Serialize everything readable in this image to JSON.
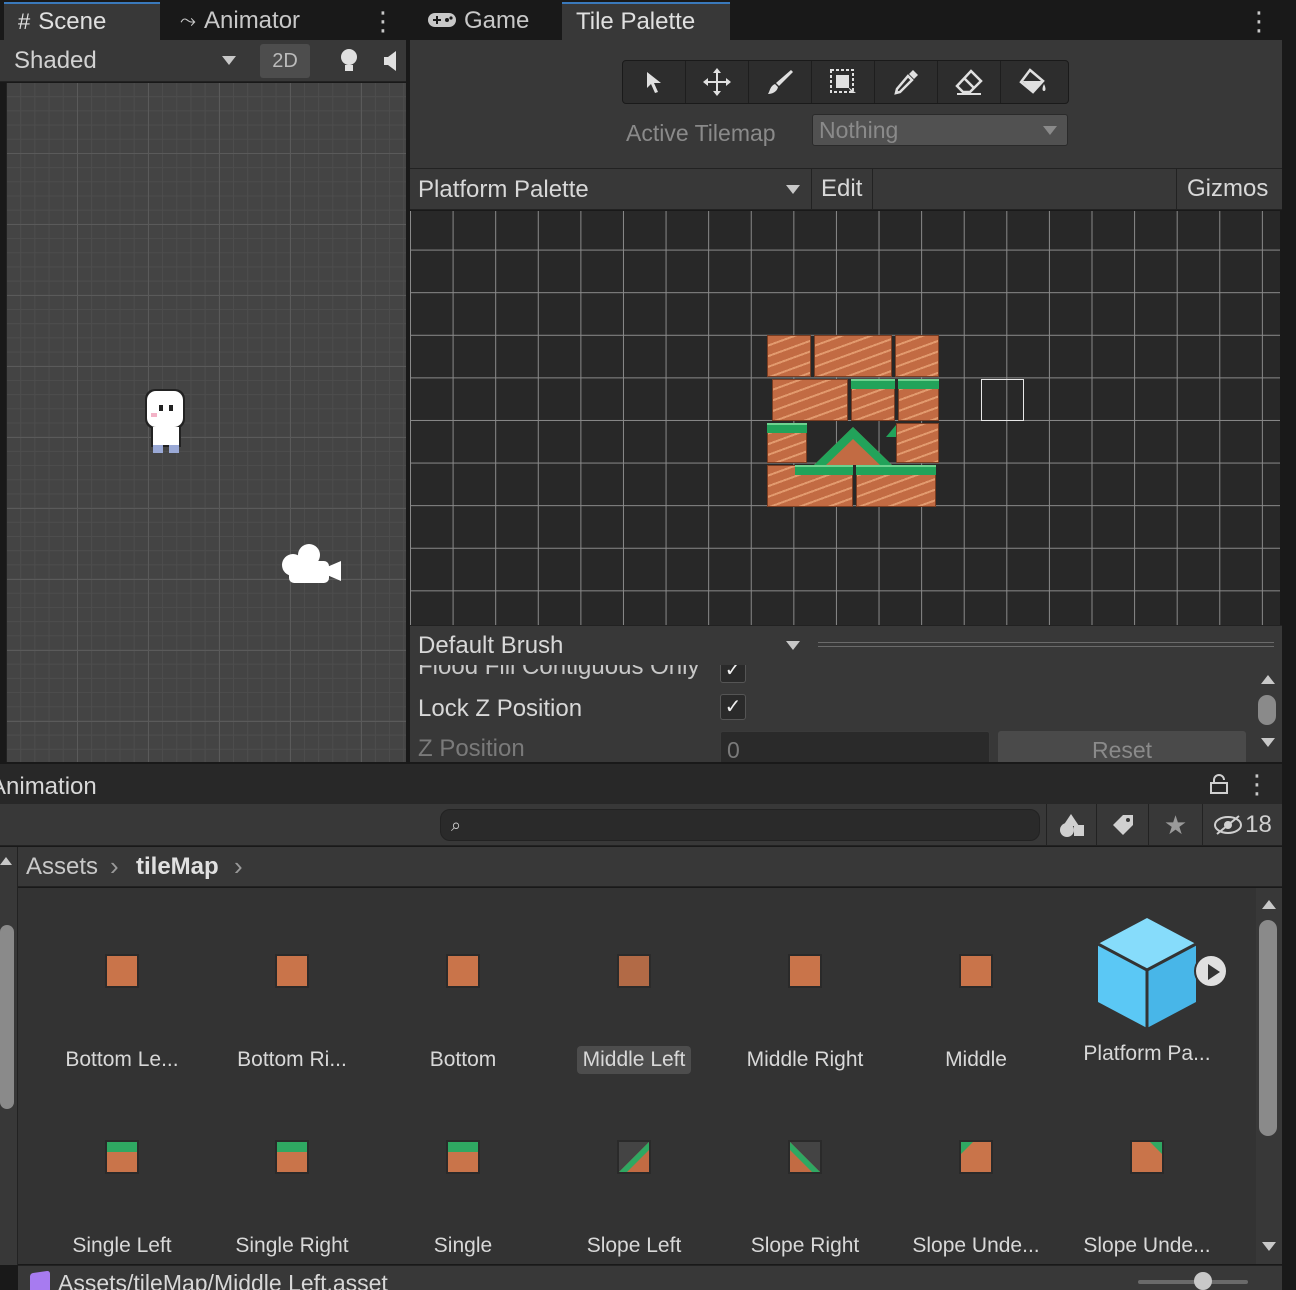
{
  "scene_panel": {
    "tabs": [
      {
        "icon": "hash-icon",
        "label": "Scene"
      },
      {
        "icon": "animator-icon",
        "label": "Animator"
      }
    ],
    "shading_mode": "Shaded",
    "mode_2d": "2D"
  },
  "palette_panel": {
    "tabs": [
      {
        "icon": "gamepad-icon",
        "label": "Game"
      },
      {
        "icon": "",
        "label": "Tile Palette"
      }
    ],
    "tools": [
      "select-tool",
      "move-tool",
      "paint-brush-tool",
      "box-fill-tool",
      "picker-tool",
      "eraser-tool",
      "fill-tool"
    ],
    "active_tilemap_label": "Active Tilemap",
    "active_tilemap_value": "Nothing",
    "palette_name": "Platform Palette",
    "edit_label": "Edit",
    "gizmos_label": "Gizmos",
    "brush_name": "Default Brush",
    "brush_settings": {
      "flood_fill_label": "Flood Fill Contiguous Only",
      "lock_z_label": "Lock Z Position",
      "z_position_label": "Z Position",
      "z_position_value": "0",
      "reset_label": "Reset"
    }
  },
  "project_panel": {
    "title": "Animation",
    "search_placeholder": "",
    "hidden_count": "18",
    "breadcrumb": [
      "Assets",
      "tileMap"
    ],
    "assets_row1": [
      {
        "label": "Bottom Le...",
        "type": "dirt",
        "selected": false
      },
      {
        "label": "Bottom Ri...",
        "type": "dirt",
        "selected": false
      },
      {
        "label": "Bottom",
        "type": "dirt",
        "selected": false
      },
      {
        "label": "Middle Left",
        "type": "dirt",
        "selected": true
      },
      {
        "label": "Middle Right",
        "type": "dirt",
        "selected": false
      },
      {
        "label": "Middle",
        "type": "dirt",
        "selected": false
      },
      {
        "label": "Platform Pa...",
        "type": "prefab",
        "selected": false
      }
    ],
    "assets_row2": [
      {
        "label": "Single Left",
        "type": "grass"
      },
      {
        "label": "Single Right",
        "type": "grass"
      },
      {
        "label": "Single",
        "type": "grass"
      },
      {
        "label": "Slope Left",
        "type": "slope-left"
      },
      {
        "label": "Slope Right",
        "type": "slope-right"
      },
      {
        "label": "Slope Unde...",
        "type": "slope-under-left"
      },
      {
        "label": "Slope Unde...",
        "type": "slope-under-right"
      }
    ],
    "status_path": "Assets/tileMap/Middle Left.asset"
  },
  "colors": {
    "accent": "#3a79bb",
    "dirt": "#c26b43",
    "grass": "#2fa862",
    "prefab_cube": "#5bc8f5"
  }
}
